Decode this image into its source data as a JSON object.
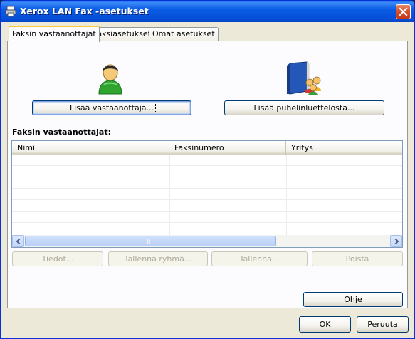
{
  "window": {
    "title": "Xerox LAN Fax -asetukset",
    "icons": {
      "app": "printer-icon",
      "close": "close-icon"
    }
  },
  "tabs": [
    {
      "label": "Faksin vastaanottajat",
      "active": true
    },
    {
      "label": "Faksiasetukset",
      "active": false
    },
    {
      "label": "Omat asetukset",
      "active": false
    }
  ],
  "recipient_actions": {
    "add_recipient": {
      "label": "Lisää vastaanottaja...",
      "icon": "user-icon"
    },
    "add_from_phonebook": {
      "label": "Lisää puhelinluettelosta...",
      "icon": "phonebook-icon"
    }
  },
  "recipients": {
    "section_label": "Faksin vastaanottajat:",
    "columns": [
      "Nimi",
      "Faksinumero",
      "Yritys"
    ],
    "rows": []
  },
  "list_actions": {
    "details": "Tiedot...",
    "save_group": "Tallenna ryhmä...",
    "save": "Tallenna...",
    "remove": "Poista"
  },
  "help_button": "Ohje",
  "dialog_buttons": {
    "ok": "OK",
    "cancel": "Peruuta"
  },
  "colors": {
    "titlebar": "#0650d8",
    "dialog_background": "#ece9d8",
    "active_tab_highlight": "#ffc83c",
    "scrollbar": "#c3d6fd"
  }
}
